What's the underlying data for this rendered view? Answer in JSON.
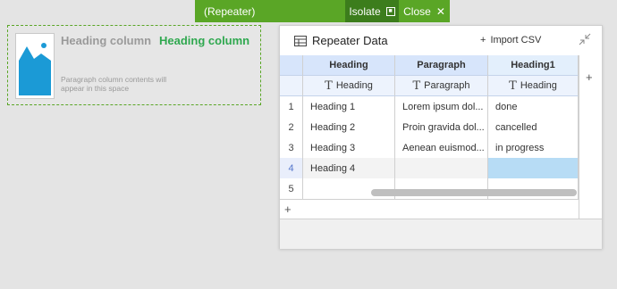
{
  "toolbar": {
    "title": "(Repeater)",
    "isolate_label": "Isolate",
    "close_label": "Close"
  },
  "repeater": {
    "heading_left": "Heading column",
    "heading_right": "Heading column",
    "paragraph": "Paragraph column contents will appear in this space"
  },
  "panel": {
    "title": "Repeater Data",
    "import_label": "Import CSV",
    "columns": [
      {
        "name": "Heading",
        "type": "Heading"
      },
      {
        "name": "Paragraph",
        "type": "Paragraph"
      },
      {
        "name": "Heading1",
        "type": "Heading"
      }
    ],
    "rows": [
      {
        "num": "1",
        "cells": [
          "Heading 1",
          "Lorem ipsum dol...",
          "done"
        ]
      },
      {
        "num": "2",
        "cells": [
          "Heading 2",
          "Proin gravida dol...",
          "cancelled"
        ]
      },
      {
        "num": "3",
        "cells": [
          "Heading 3",
          "Aenean euismod...",
          "in progress"
        ]
      },
      {
        "num": "4",
        "cells": [
          "Heading 4",
          "",
          ""
        ]
      },
      {
        "num": "5",
        "cells": [
          "",
          "",
          ""
        ]
      }
    ],
    "add_column_symbol": "+",
    "add_row_symbol": "+"
  },
  "colors": {
    "toolbar_green": "#5aa626",
    "heading_green": "#2fa84f",
    "header_blue": "#d7e5fb",
    "selected_cell": "#b7dcf5"
  }
}
